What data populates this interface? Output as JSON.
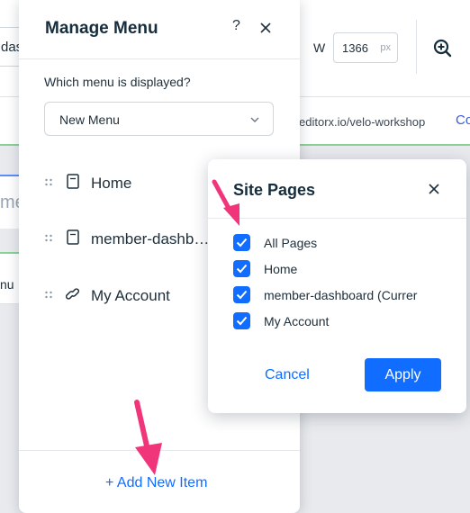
{
  "background": {
    "left_field_text": "das",
    "width_label": "W",
    "width_value": "1366",
    "width_unit": "px",
    "url_text": "editorx.io/velo-workshop",
    "url_more": "Co",
    "canvas_fragment_1": "me",
    "canvas_fragment_2": "nu",
    "icons": {
      "zoom": "zoom-in-icon"
    }
  },
  "manage_menu": {
    "title": "Manage Menu",
    "help_label": "?",
    "question": "Which menu is displayed?",
    "selected_menu": "New Menu",
    "items": [
      {
        "label": "Home",
        "icon": "page-icon"
      },
      {
        "label": "member-dashb…",
        "icon": "page-icon"
      },
      {
        "label": "My Account",
        "icon": "link-icon"
      }
    ],
    "add_item_label": "+ Add New Item"
  },
  "site_pages": {
    "title": "Site Pages",
    "options": [
      {
        "label": "All Pages",
        "checked": true
      },
      {
        "label": "Home",
        "checked": true
      },
      {
        "label": "member-dashboard (Currer",
        "checked": true
      },
      {
        "label": "My Account",
        "checked": true
      }
    ],
    "cancel_label": "Cancel",
    "apply_label": "Apply"
  },
  "colors": {
    "accent": "#116dff",
    "annotation_arrow": "#f0357a",
    "title_text": "#162d3d"
  }
}
